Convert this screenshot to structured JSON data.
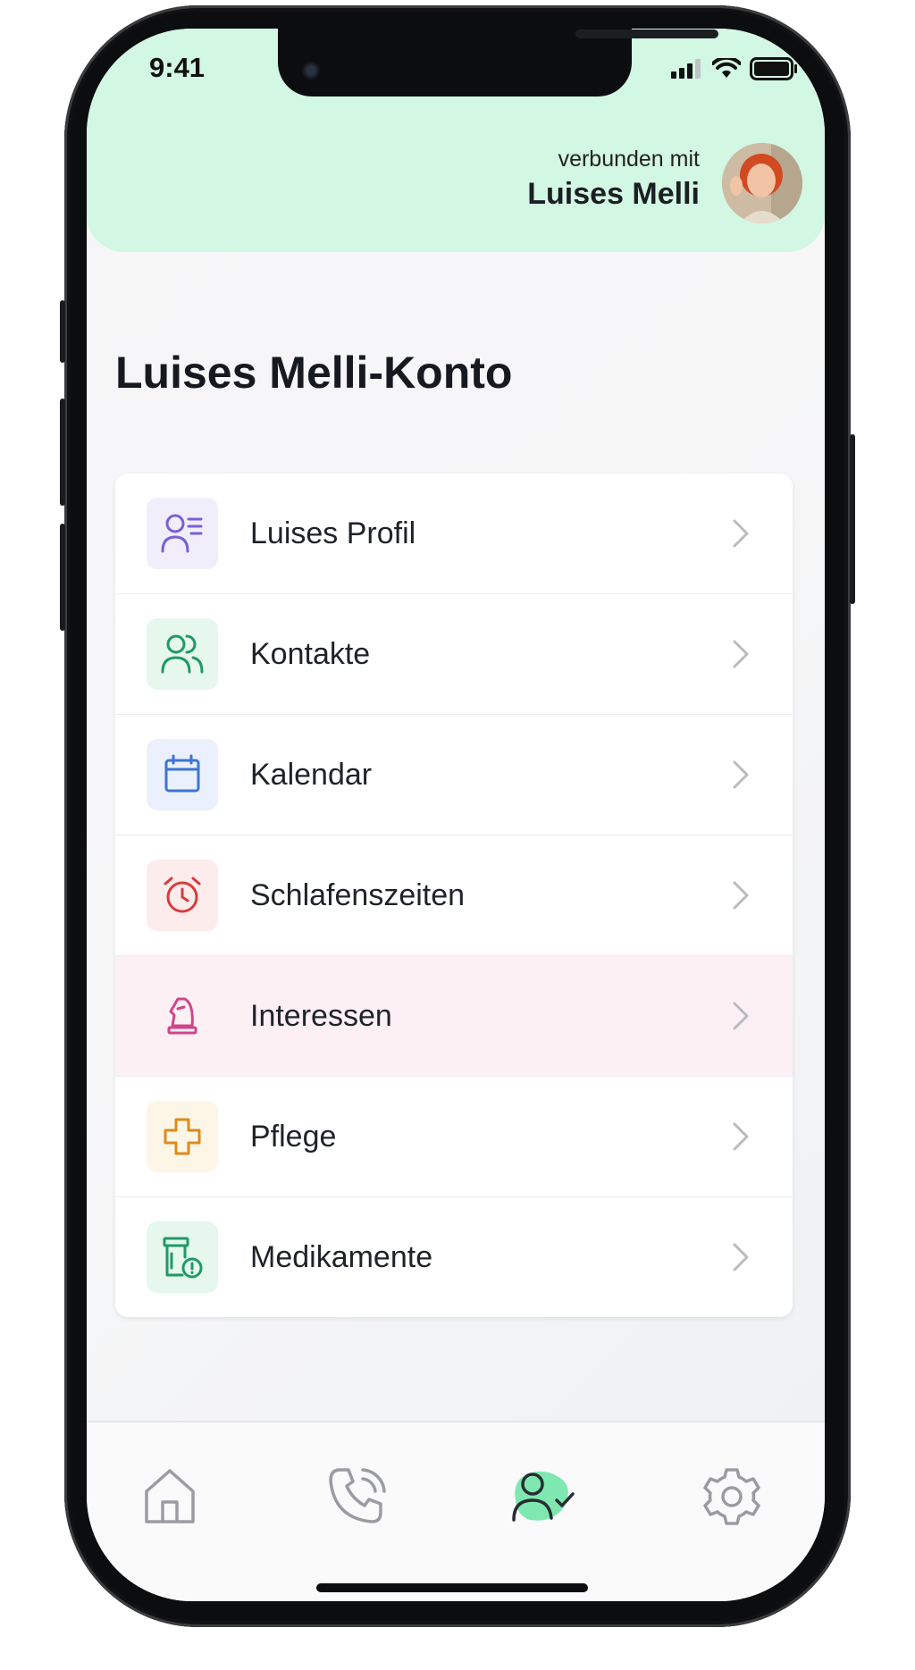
{
  "status_bar": {
    "time": "9:41"
  },
  "header": {
    "connected_label": "verbunden mit",
    "connected_name": "Luises Melli"
  },
  "page": {
    "title": "Luises Melli-Konto"
  },
  "menu": {
    "items": [
      {
        "label": "Luises Profil",
        "icon": "profile-list-icon",
        "color": "#7b5fd6",
        "bg": "#f1eefc"
      },
      {
        "label": "Kontakte",
        "icon": "contacts-icon",
        "color": "#1f9a66",
        "bg": "#e6f7ee"
      },
      {
        "label": "Kalendar",
        "icon": "calendar-icon",
        "color": "#3d74d6",
        "bg": "#eaf1fc"
      },
      {
        "label": "Schlafenszeiten",
        "icon": "alarm-clock-icon",
        "color": "#d93b3b",
        "bg": "#fdecec"
      },
      {
        "label": "Interessen",
        "icon": "chess-knight-icon",
        "color": "#d0468a",
        "bg": "#fcf0f4"
      },
      {
        "label": "Pflege",
        "icon": "cross-plus-icon",
        "color": "#dd8a1d",
        "bg": "#fdf6e6"
      },
      {
        "label": "Medikamente",
        "icon": "medication-icon",
        "color": "#1f9a66",
        "bg": "#e6f7ee"
      }
    ]
  },
  "tabbar": {
    "tabs": [
      {
        "name": "home",
        "icon": "home-icon",
        "active": false
      },
      {
        "name": "calls",
        "icon": "phone-icon",
        "active": false
      },
      {
        "name": "account",
        "icon": "user-check-icon",
        "active": true
      },
      {
        "name": "settings",
        "icon": "gear-icon",
        "active": false
      }
    ]
  },
  "colors": {
    "header_bg": "#d2f7e2",
    "accent_green": "#7fe8b0",
    "icon_gray": "#9a9ca2"
  }
}
